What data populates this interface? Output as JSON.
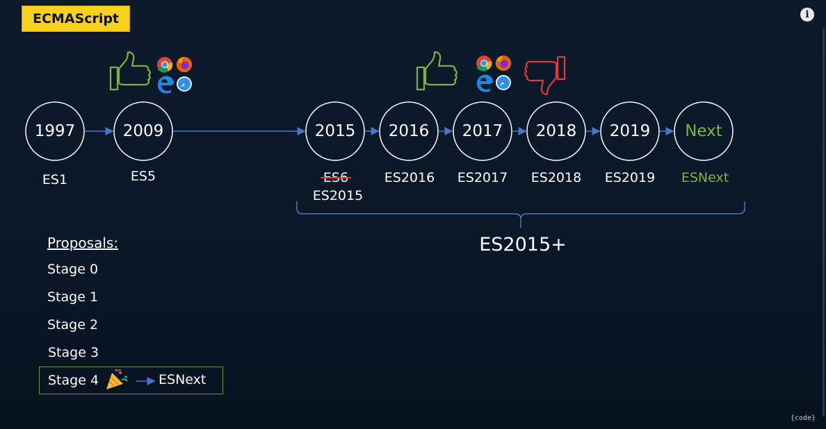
{
  "title": "ECMAScript",
  "timeline": {
    "years": [
      "1997",
      "2009",
      "2015",
      "2016",
      "2017",
      "2018",
      "2019",
      "Next"
    ],
    "editions": {
      "es1": "ES1",
      "es5": "ES5",
      "es6_struck": "ES6",
      "es2015": "ES2015",
      "es2016": "ES2016",
      "es2017": "ES2017",
      "es2018": "ES2018",
      "es2019": "ES2019",
      "esnext": "ESNext"
    },
    "brace_label": "ES2015+"
  },
  "proposals": {
    "heading": "Proposals:",
    "stages": [
      "Stage 0",
      "Stage 1",
      "Stage 2",
      "Stage 3",
      "Stage 4"
    ],
    "result": "ESNext"
  },
  "icons": [
    "thumbs-up-icon",
    "chrome-icon",
    "firefox-icon",
    "edge-icon",
    "safari-icon",
    "thumbs-down-icon",
    "party-popper-icon",
    "info-icon"
  ],
  "colors": {
    "badge": "#f9d21c",
    "circle": "#ffffff",
    "arrow": "#4a74c9",
    "next_green": "#7cb342",
    "thumbs_up": "#7cb342",
    "thumbs_down": "#e53935"
  },
  "watermark": "{code}"
}
